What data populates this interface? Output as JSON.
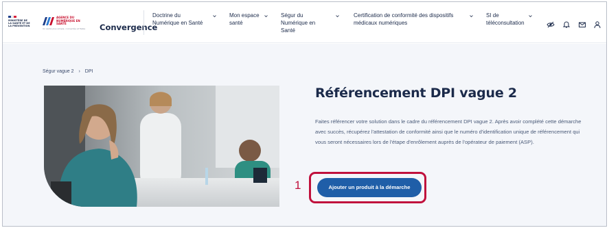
{
  "header": {
    "rf_logo_text": "MINISTÈRE DE LA SANTÉ ET DE LA PRÉVENTION",
    "ans_logo_name": "AGENCE DU NUMÉRIQUE EN SANTÉ",
    "ans_logo_tagline": "Un santé plus simple, connectée et fiable",
    "brand": "Convergence",
    "nav": [
      {
        "label": "Doctrine du Numérique en Santé"
      },
      {
        "label": "Mon espace santé"
      },
      {
        "label": "Ségur du Numérique en Santé"
      },
      {
        "label": "Certification de conformité des dispositifs médicaux numériques"
      },
      {
        "label": "SI de téléconsultation"
      }
    ],
    "icons": [
      "eye-off-icon",
      "bell-icon",
      "mail-icon",
      "user-icon"
    ]
  },
  "breadcrumb": {
    "items": [
      "Ségur vague 2",
      "›",
      "DPI"
    ]
  },
  "main": {
    "title": "Référencement DPI vague 2",
    "description": "Faites référencer votre solution dans le cadre du référencement DPI vague 2. Après avoir complété cette démarche avec succès, récupérez l'attestation de conformité ainsi que le numéro d'identification unique de référencement qui vous seront nécessaires lors de l'étape d'enrôlement auprès de l'opérateur de paiement (ASP).",
    "cta_label": "Ajouter un produit à la démarche",
    "annotation_number": "1"
  },
  "colors": {
    "brand_blue": "#1f5ea8",
    "highlight_red": "#c0103c",
    "navy": "#1b2a4a",
    "background": "#f4f6fa"
  }
}
